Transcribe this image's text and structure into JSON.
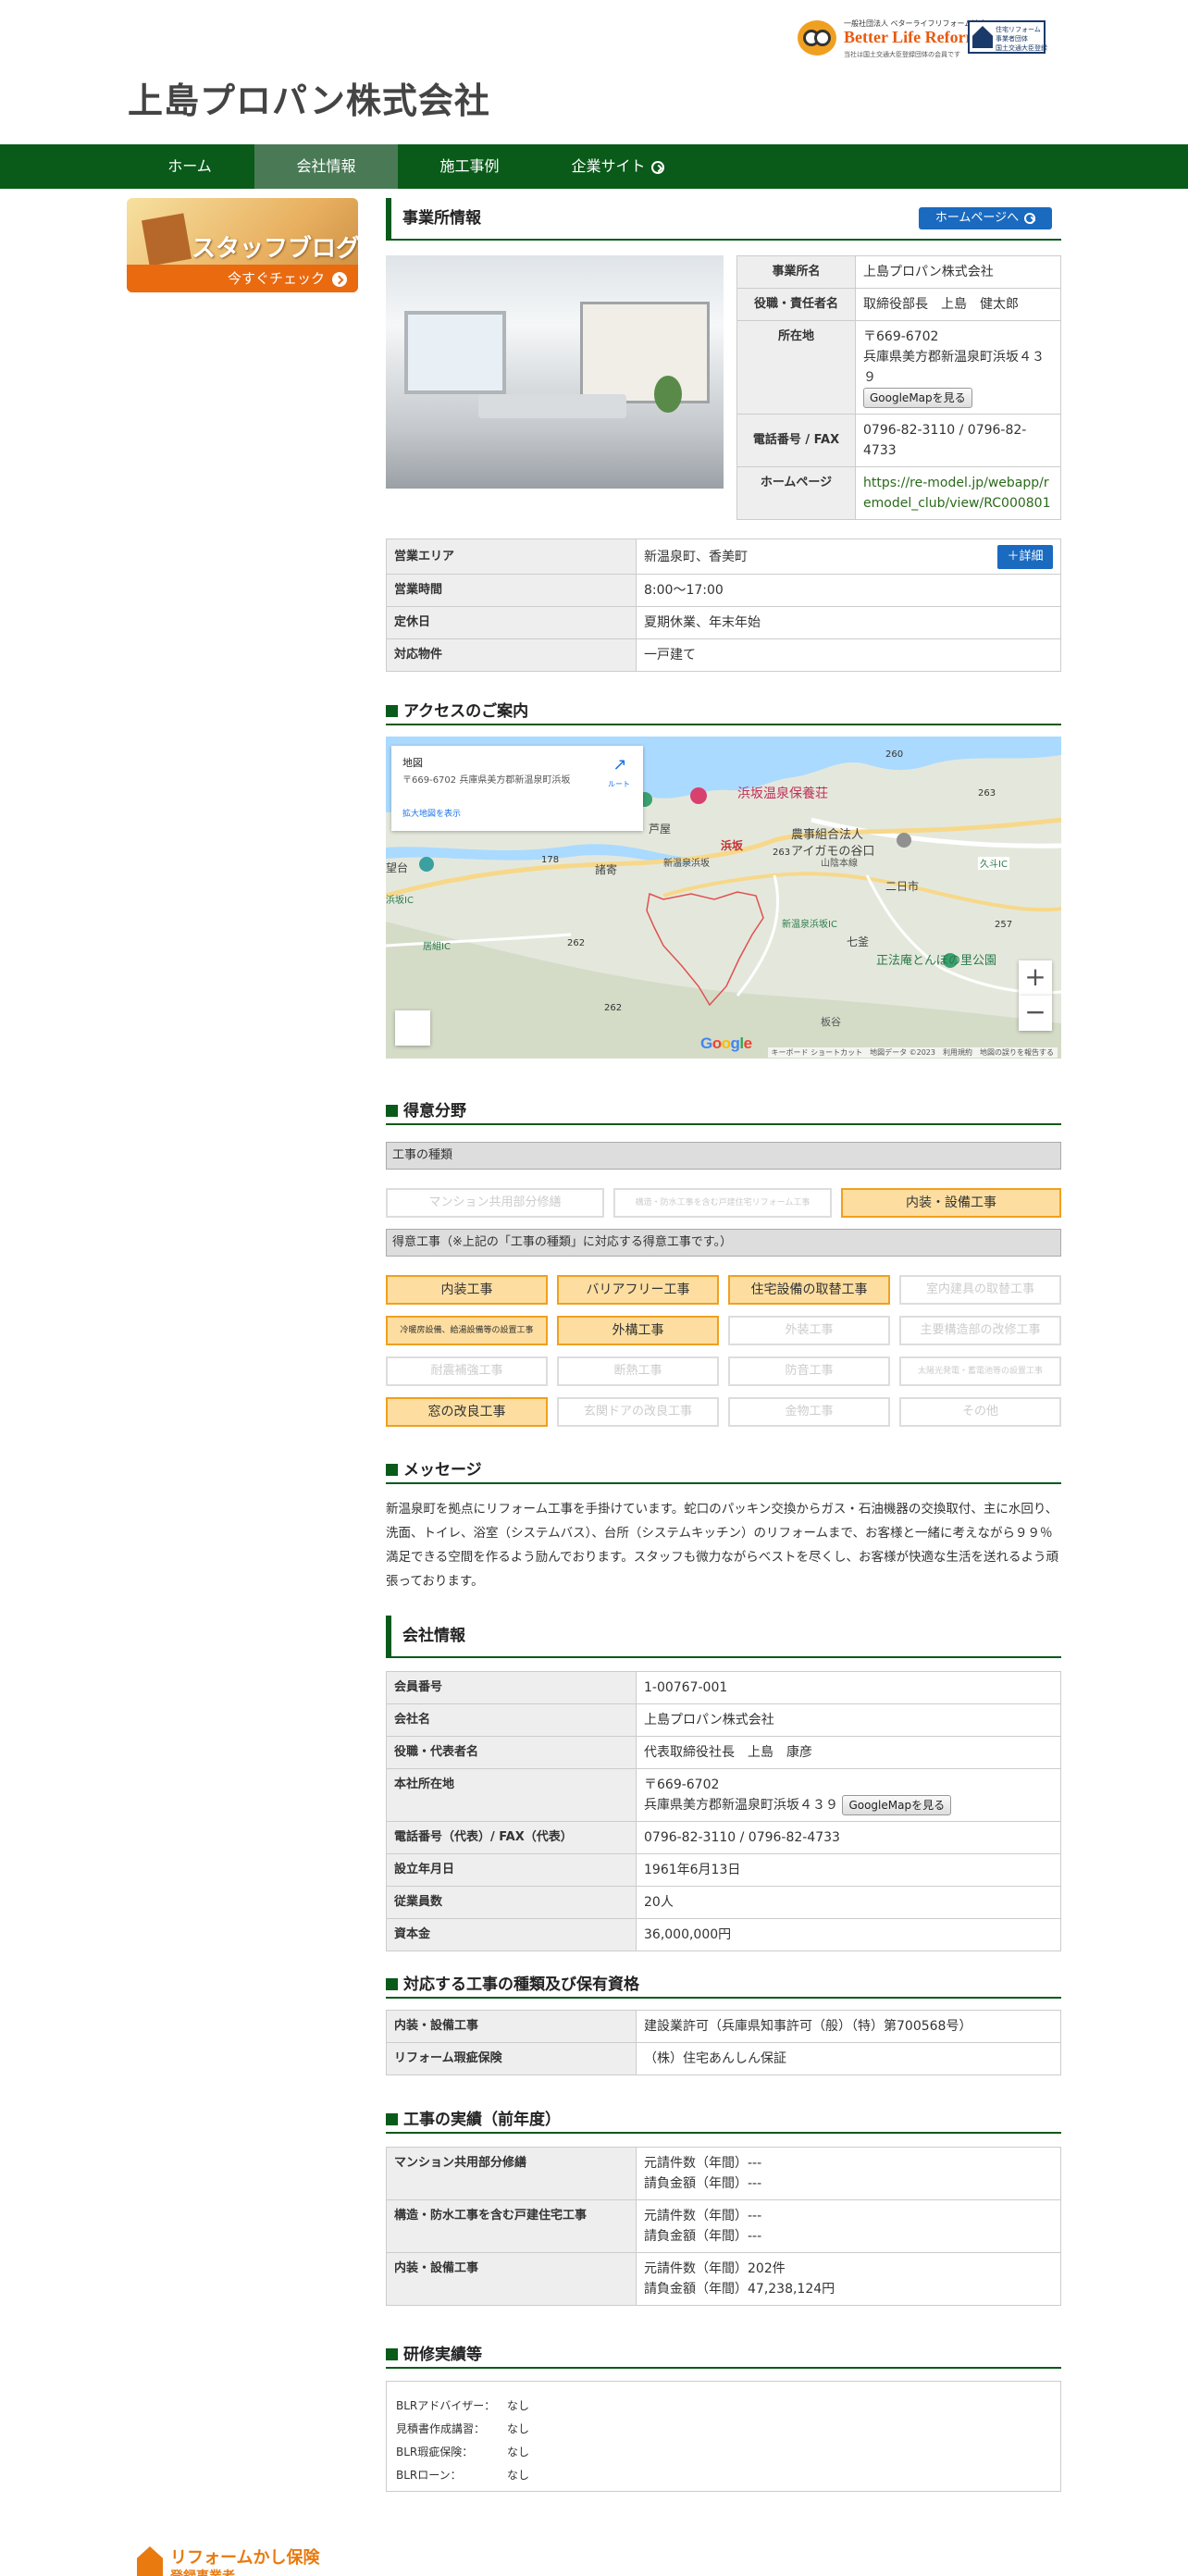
{
  "header": {
    "site_title": "上島プロパン株式会社",
    "blr_small": "一般社団法人 ベターライフリフォーム協会",
    "blr_main": "Better Life Reform",
    "blr_sub": "当社は国土交通大臣登録団体の会員です",
    "reg_badge_l1": "住宅リフォーム",
    "reg_badge_l2": "事業者団体",
    "reg_badge_l3": "国土交通大臣登録"
  },
  "nav": {
    "items": [
      "ホーム",
      "会社情報",
      "施工事例",
      "企業サイト"
    ],
    "active_index": 1
  },
  "sidebar": {
    "banner_title": "スタッフブログ",
    "banner_cta": "今すぐチェック"
  },
  "office": {
    "heading": "事業所情報",
    "homepage_button": "ホームページへ",
    "rows": [
      {
        "label": "事業所名",
        "value": "上島プロパン株式会社"
      },
      {
        "label": "役職・責任者名",
        "value": "取締役部長　上島　健太郎"
      },
      {
        "label": "所在地",
        "postal": "〒669-6702",
        "value": "兵庫県美方郡新温泉町浜坂４３９"
      },
      {
        "label": "電話番号 / FAX",
        "value": "0796-82-3110 / 0796-82-4733"
      },
      {
        "label": "ホームページ",
        "value": "https://re-model.jp/webapp/remodel_club/view/RC000801"
      }
    ],
    "googlemap_button": "GoogleMapを見る"
  },
  "business": {
    "rows": [
      {
        "label": "営業エリア",
        "value": "新温泉町、香美町"
      },
      {
        "label": "営業時間",
        "value": "8:00～17:00"
      },
      {
        "label": "定休日",
        "value": "夏期休業、年末年始"
      },
      {
        "label": "対応物件",
        "value": "一戸建て"
      }
    ],
    "detail_button": "＋詳細"
  },
  "access": {
    "heading": "アクセスのご案内",
    "card_title": "地図",
    "card_address": "〒669-6702 兵庫県美方郡新温泉町浜坂",
    "card_link": "拡大地図を表示",
    "card_route": "ルート",
    "labels": [
      "浜坂温泉保養荘",
      "農事組合法人",
      "アイガモの谷口",
      "浜坂",
      "二日市",
      "七釜",
      "正法庵とんぼの里公園",
      "新温泉浜坂IC",
      "山陰本線",
      "久斗IC",
      "芦屋",
      "諸寄",
      "新温泉浜坂",
      "浜坂IC",
      "居組IC",
      "望台",
      "板谷"
    ],
    "road_numbers": [
      "260",
      "263",
      "178",
      "262",
      "257",
      "262",
      "263"
    ],
    "zoom_in": "+",
    "zoom_out": "−",
    "google": "Google",
    "footer": "キーボード ショートカット　地図データ ©2023　利用規約　地図の誤りを報告する"
  },
  "specialty": {
    "heading": "得意分野",
    "bar1": "工事の種類",
    "types": [
      {
        "label": "マンション共用部分修繕",
        "on": false
      },
      {
        "label": "構造・防水工事を含む戸建住宅リフォーム工事",
        "on": false
      },
      {
        "label": "内装・設備工事",
        "on": true
      }
    ],
    "bar2": "得意工事（※上記の「工事の種類」に対応する得意工事です。）",
    "works": [
      {
        "label": "内装工事",
        "on": true
      },
      {
        "label": "バリアフリー工事",
        "on": true
      },
      {
        "label": "住宅設備の取替工事",
        "on": true
      },
      {
        "label": "室内建具の取替工事",
        "on": false
      },
      {
        "label": "冷暖房設備、給湯設備等の設置工事",
        "on": true
      },
      {
        "label": "外構工事",
        "on": true
      },
      {
        "label": "外装工事",
        "on": false
      },
      {
        "label": "主要構造部の改修工事",
        "on": false
      },
      {
        "label": "耐震補強工事",
        "on": false
      },
      {
        "label": "断熱工事",
        "on": false
      },
      {
        "label": "防音工事",
        "on": false
      },
      {
        "label": "太陽光発電・蓄電池等の設置工事",
        "on": false
      },
      {
        "label": "窓の改良工事",
        "on": true
      },
      {
        "label": "玄関ドアの改良工事",
        "on": false
      },
      {
        "label": "金物工事",
        "on": false
      },
      {
        "label": "その他",
        "on": false
      }
    ]
  },
  "message": {
    "heading": "メッセージ",
    "body": "新温泉町を拠点にリフォーム工事を手掛けています。蛇口のパッキン交換からガス・石油機器の交換取付、主に水回り、洗面、トイレ、浴室（システムバス）、台所（システムキッチン）のリフォームまで、お客様と一緒に考えながら９９％満足できる空間を作るよう励んでおります。スタッフも微力ながらベストを尽くし、お客様が快適な生活を送れるよう頑張っております。"
  },
  "company": {
    "heading": "会社情報",
    "rows": [
      {
        "label": "会員番号",
        "value": "1-00767-001"
      },
      {
        "label": "会社名",
        "value": "上島プロパン株式会社"
      },
      {
        "label": "役職・代表者名",
        "value": "代表取締役社長　上島　康彦"
      },
      {
        "label": "本社所在地",
        "postal": "〒669-6702",
        "value": "兵庫県美方郡新温泉町浜坂４３９"
      },
      {
        "label": "電話番号（代表）/ FAX（代表）",
        "value": "0796-82-3110 / 0796-82-4733"
      },
      {
        "label": "設立年月日",
        "value": "1961年6月13日"
      },
      {
        "label": "従業員数",
        "value": "20人"
      },
      {
        "label": "資本金",
        "value": "36,000,000円"
      }
    ],
    "googlemap_button": "GoogleMapを見る"
  },
  "licenses": {
    "heading": "対応する工事の種類及び保有資格",
    "rows": [
      {
        "label": "内装・設備工事",
        "value": "建設業許可（兵庫県知事許可（般）（特）第700568号）"
      },
      {
        "label": "リフォーム瑕疵保険",
        "value": "（株）住宅あんしん保証"
      }
    ]
  },
  "results": {
    "heading": "工事の実績（前年度）",
    "rows": [
      {
        "label": "マンション共用部分修繕",
        "count": "元請件数（年間）---",
        "amount": "請負金額（年間）---"
      },
      {
        "label": "構造・防水工事を含む戸建住宅工事",
        "count": "元請件数（年間）---",
        "amount": "請負金額（年間）---"
      },
      {
        "label": "内装・設備工事",
        "count": "元請件数（年間）202件",
        "amount": "請負金額（年間）47,238,124円"
      }
    ]
  },
  "training": {
    "heading": "研修実績等",
    "rows": [
      {
        "label": "BLRアドバイザー：",
        "value": "なし"
      },
      {
        "label": "見積書作成講習：",
        "value": "なし"
      },
      {
        "label": "BLR瑕疵保険：",
        "value": "なし"
      },
      {
        "label": "BLRローン：",
        "value": "なし"
      }
    ]
  },
  "footer": {
    "logo_l1": "リフォームかし保険",
    "logo_l2": "登録事業者"
  }
}
